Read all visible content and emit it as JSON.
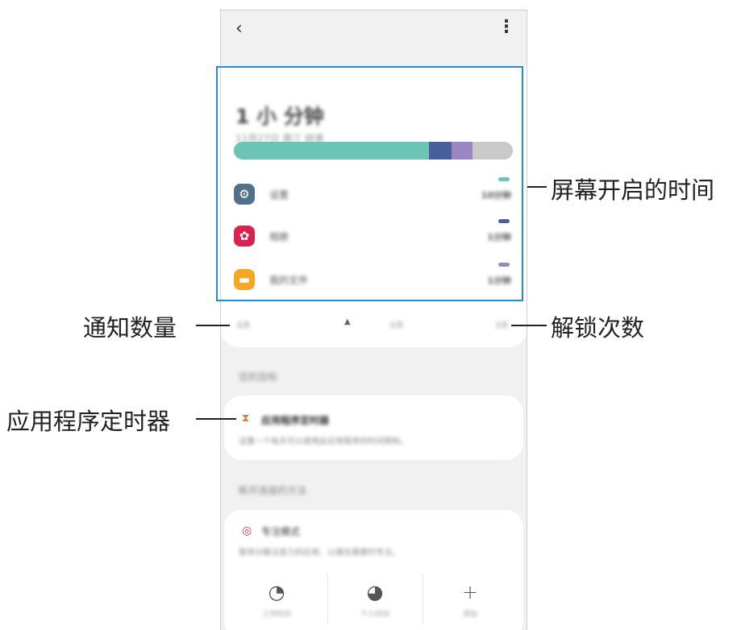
{
  "callouts": {
    "screen_time": "屏幕开启的时间",
    "notifications": "通知数量",
    "unlocks": "解锁次数",
    "app_timer": "应用程序定时器"
  },
  "screen": {
    "total_time": "1 小 分钟",
    "date_sub": "11月27日 周三 结束",
    "bar_segments": [
      {
        "fraction": 0.7,
        "color": "#6cc5b4"
      },
      {
        "fraction": 0.08,
        "color": "#47609b"
      },
      {
        "fraction": 0.075,
        "color": "#9a86c3"
      },
      {
        "fraction": 0.145,
        "color": "#c9c9c9"
      }
    ],
    "apps": [
      {
        "name": "设置",
        "time": "10分钟",
        "icon": "gear-icon",
        "color": "#51718b",
        "dash": "#6cc5b4"
      },
      {
        "name": "相册",
        "time": "1分钟",
        "icon": "flower-icon",
        "color": "#d7234e",
        "dash": "#47609b"
      },
      {
        "name": "我的文件",
        "time": "1分钟",
        "icon": "folder-icon",
        "color": "#f5a623",
        "dash": "#9a86c3"
      }
    ],
    "stats": {
      "notifications": "0次",
      "bell_icon": "bell-icon",
      "mid": "0次",
      "unlocks": "3次"
    }
  },
  "timers": {
    "section_title": "您的目标",
    "title": "应用程序定时器",
    "desc": "设置一个每天可以使用此应用程序的时间限制。"
  },
  "focus": {
    "section_title": "断开连接的方法",
    "title": "专注模式",
    "desc": "暂停分散注意力的应用，以便在需要时专注。",
    "buttons": [
      {
        "label": "工作时间",
        "icon": "work-mode-icon"
      },
      {
        "label": "个人时间",
        "icon": "me-time-icon"
      },
      {
        "label": "添加",
        "icon": "plus-icon"
      }
    ]
  }
}
